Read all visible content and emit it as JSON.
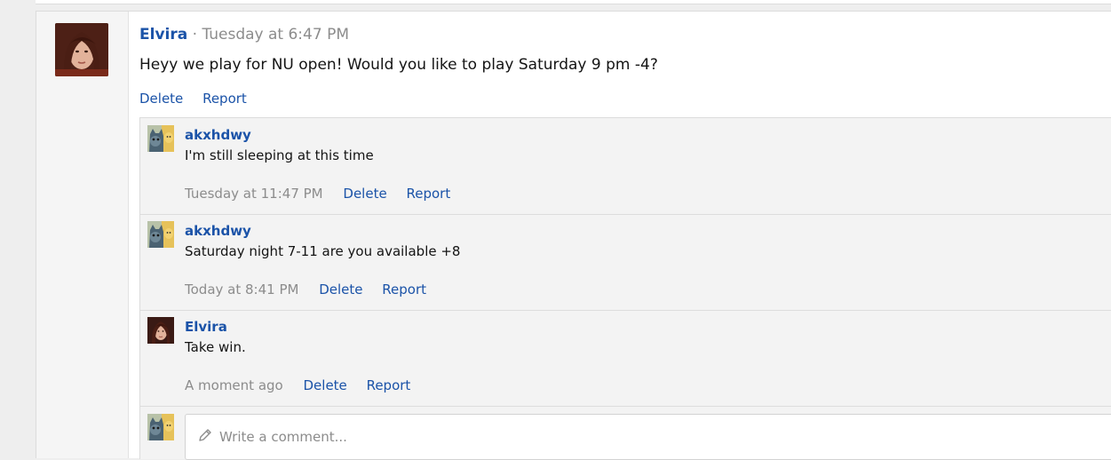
{
  "post": {
    "author": "Elvira",
    "separator": "·",
    "timestamp": "Tuesday at 6:47 PM",
    "message": "Heyy we play for NU open! Would you like to play Saturday 9 pm -4?",
    "actions": {
      "delete": "Delete",
      "report": "Report"
    }
  },
  "comments": [
    {
      "author": "akxhdwy",
      "text": "I'm still sleeping at this time",
      "time": "Tuesday at 11:47 PM",
      "delete": "Delete",
      "report": "Report"
    },
    {
      "author": "akxhdwy",
      "text": "Saturday night 7-11 are you available +8",
      "time": "Today at 8:41 PM",
      "delete": "Delete",
      "report": "Report"
    },
    {
      "author": "Elvira",
      "text": "Take win.",
      "time": "A moment ago",
      "delete": "Delete",
      "report": "Report"
    }
  ],
  "reply": {
    "placeholder": "Write a comment...",
    "icon": "pencil-icon"
  },
  "colors": {
    "link": "#1b53a8",
    "muted": "#8c8c8c",
    "comment_bg": "#f3f3f3",
    "page_bg": "#eeeeee"
  }
}
